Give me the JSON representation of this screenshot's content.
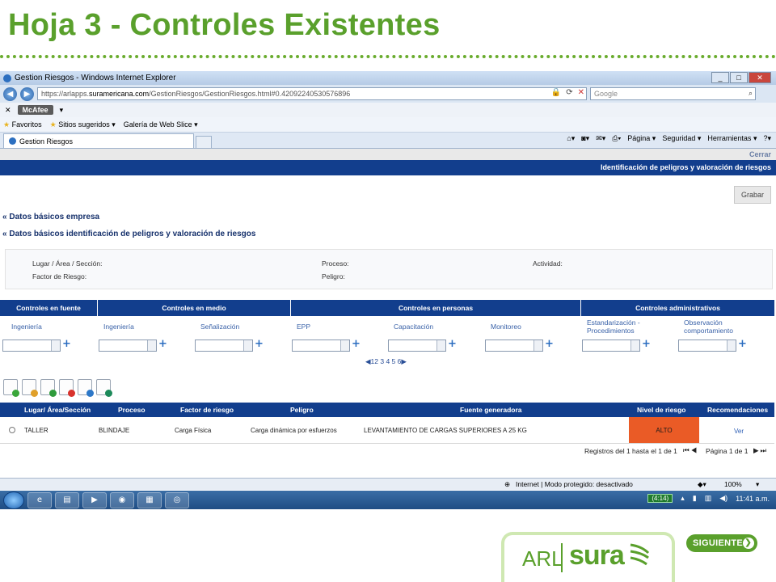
{
  "slide": {
    "title": "Hoja 3 - Controles Existentes"
  },
  "browser": {
    "window_title": "Gestion Riesgos - Windows Internet Explorer",
    "url_prefix": "https://arlapps.",
    "url_domain": "suramericana.com",
    "url_rest": "/GestionRiesgos/GestionRiesgos.html#0.42092240530576896",
    "search_placeholder": "Google",
    "mcafee": "McAfee",
    "favorites": {
      "favoritos": "Favoritos",
      "sitios": "Sitios sugeridos",
      "galeria": "Galería de Web Slice"
    },
    "tab_title": "Gestion Riesgos",
    "cmdbar": {
      "pagina": "Página",
      "seguridad": "Seguridad",
      "herramientas": "Herramientas"
    },
    "status": {
      "zone": "Internet | Modo protegido: desactivado",
      "zoom": "100%"
    }
  },
  "app": {
    "cerrar": "Cerrar",
    "header": "Identificación de peligros y valoración de riesgos",
    "grabar": "Grabar",
    "section1": "Datos básicos empresa",
    "section2": "Datos básicos identificación de peligros y valoración de riesgos",
    "info": {
      "lugar": "Lugar / Área / Sección:",
      "factor": "Factor de Riesgo:",
      "proceso": "Proceso:",
      "peligro": "Peligro:",
      "actividad": "Actividad:"
    },
    "control_groups": [
      "Controles en fuente",
      "Controles en medio",
      "Controles en personas",
      "Controles administrativos"
    ],
    "control_fields": [
      "Ingeniería",
      "Ingeniería",
      "Señalización",
      "EPP",
      "Capacitación",
      "Monitoreo",
      "Estandarización - Procedimientos",
      "Observación comportamiento"
    ],
    "pager": "12 3 4 5 6",
    "grid": {
      "headers": [
        "Lugar/ Área/Sección",
        "Proceso",
        "Factor de riesgo",
        "Peligro",
        "Fuente generadora",
        "Nivel de riesgo",
        "Recomendaciones"
      ],
      "rows": [
        {
          "lugar": "TALLER",
          "proceso": "BLINDAJE",
          "factor": "Carga Física",
          "peligro": "Carga dinámica por esfuerzos",
          "fuente": "LEVANTAMIENTO DE CARGAS SUPERIORES A 25 KG",
          "nivel": "ALTO",
          "recomendaciones": "Ver"
        }
      ],
      "records": "Registros del 1 hasta el 1 de 1",
      "page": "Página 1 de 1"
    }
  },
  "taskbar": {
    "battery": "(4:14)",
    "clock": "11:41 a.m."
  },
  "footer": {
    "logo_arl": "ARL",
    "logo_sura": "sura",
    "siguiente": "SIGUIENTE"
  },
  "colors": {
    "accent_green": "#5aa02c",
    "header_blue": "#123e8d",
    "risk_alto": "#ea5b26"
  }
}
